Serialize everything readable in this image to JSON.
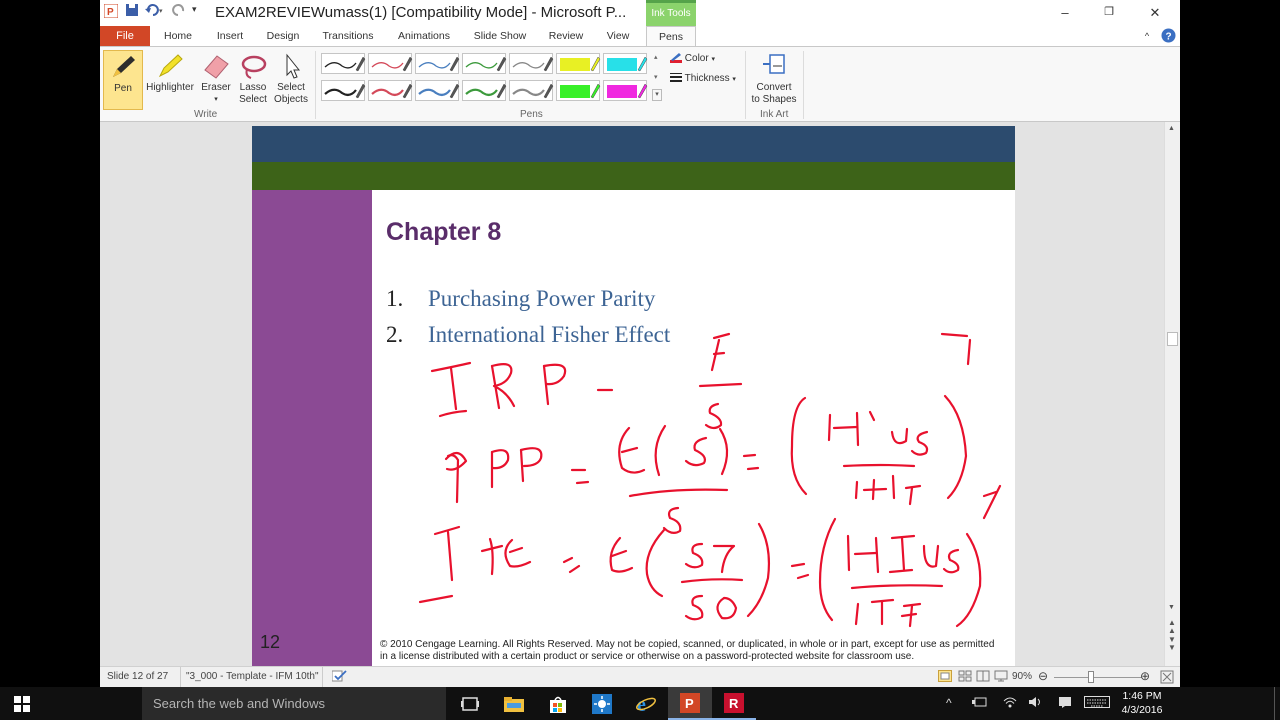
{
  "window": {
    "title": "EXAM2REVIEWumass(1) [Compatibility Mode]  -  Microsoft P...",
    "context_tab": "Ink Tools",
    "controls": {
      "minimize": "–",
      "restore": "❐",
      "close": "✕"
    }
  },
  "tabs": {
    "file": "File",
    "items": [
      "Home",
      "Insert",
      "Design",
      "Transitions",
      "Animations",
      "Slide Show",
      "Review",
      "View",
      "Pens"
    ],
    "active": "Pens"
  },
  "ribbon": {
    "write_group": {
      "label": "Write",
      "pen": "Pen",
      "highlighter": "Highlighter",
      "eraser": "Eraser",
      "lasso": [
        "Lasso",
        "Select"
      ],
      "select_objects": [
        "Select",
        "Objects"
      ]
    },
    "pens_group": {
      "label": "Pens",
      "color": "Color",
      "thickness": "Thickness",
      "pen_colors": [
        "#222222",
        "#d44a5a",
        "#4a7fbf",
        "#3c9a3c",
        "#888888",
        "#e8f024",
        "#28e0e8",
        "#222222",
        "#d44a5a",
        "#4a7fbf",
        "#3c9a3c",
        "#888888",
        "#38f028",
        "#f028e0"
      ]
    },
    "ink_art_group": {
      "label": "Ink Art",
      "convert": [
        "Convert",
        "to Shapes"
      ]
    }
  },
  "slide": {
    "title": "Chapter 8",
    "items": [
      {
        "num": "1.",
        "text": "Purchasing  Power Parity"
      },
      {
        "num": "2.",
        "text": "International Fisher Effect"
      }
    ],
    "number": "12",
    "copyright": "© 2010 Cengage Learning. All Rights Reserved. May not be copied, scanned, or duplicated, in whole or in part, except for use as permitted in a license distributed with a certain product or service or otherwise on a password-protected website for classroom use.",
    "colors": {
      "top_band": "#2c4b6e",
      "green_band": "#3d6318",
      "side_band": "#8b4a94",
      "title": "#5a2d6a",
      "list_text": "#3d6494",
      "ink": "#e8112d"
    }
  },
  "statusbar": {
    "slide_info": "Slide 12 of 27",
    "theme": "\"3_000 - Template - IFM 10th\"",
    "zoom": "90%"
  },
  "taskbar": {
    "search_placeholder": "Search the web and Windows",
    "time": "1:46 PM",
    "date": "4/3/2016"
  }
}
